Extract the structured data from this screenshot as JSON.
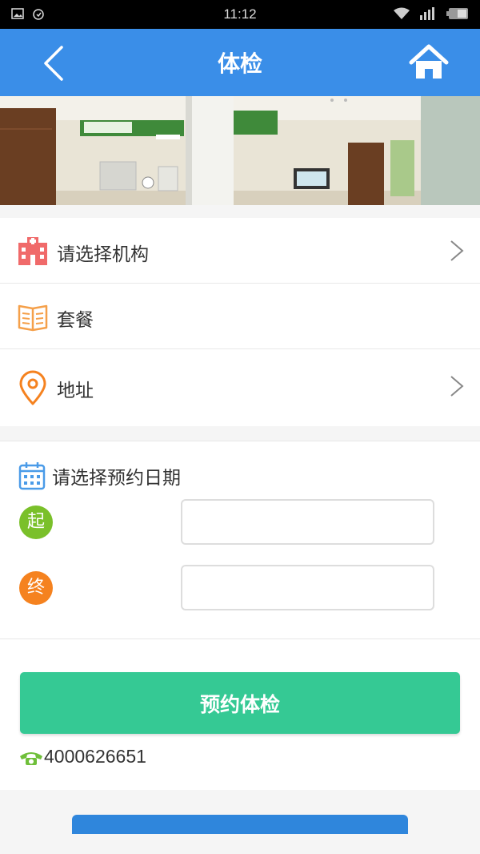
{
  "status_bar": {
    "time": "11:12"
  },
  "header": {
    "title": "体检"
  },
  "menu": [
    {
      "label": "请选择机构",
      "icon": "hospital-icon",
      "has_chevron": true
    },
    {
      "label": "套餐",
      "icon": "book-icon",
      "has_chevron": false
    },
    {
      "label": "地址",
      "icon": "location-pin-icon",
      "has_chevron": true
    }
  ],
  "date_section": {
    "label": "请选择预约日期",
    "start_badge": "起",
    "end_badge": "终",
    "start_value": "",
    "end_value": ""
  },
  "actions": {
    "book_label": "预约体检"
  },
  "contact": {
    "phone": "4000626651"
  },
  "colors": {
    "header": "#3a8ee8",
    "book_button": "#35c994",
    "start_badge": "#7ac02a",
    "end_badge": "#f5821f",
    "hospital_icon": "#f06a6a",
    "book_icon": "#f5a04a",
    "location_icon": "#f5821f",
    "phone_icon": "#6fbf3a"
  }
}
